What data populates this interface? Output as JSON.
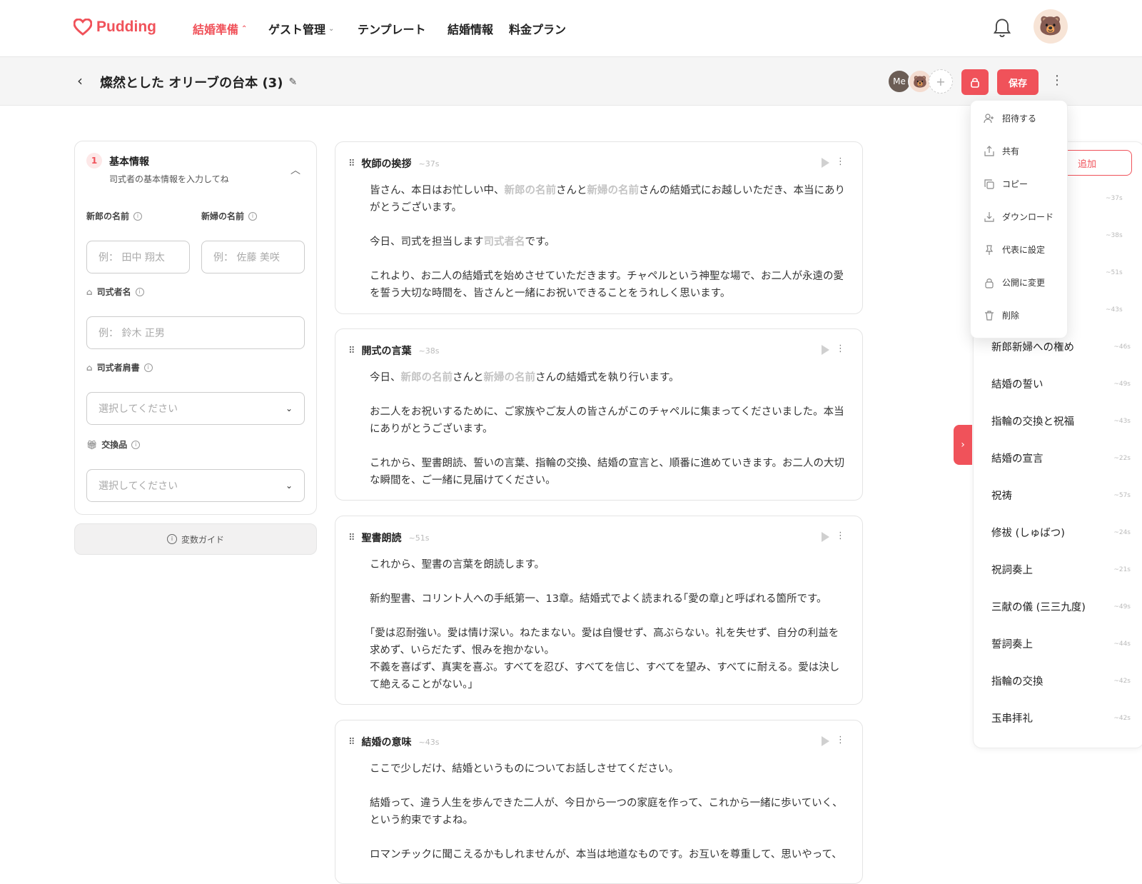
{
  "nav": {
    "logo": "Pudding",
    "items": [
      {
        "label": "結婚準備",
        "active": true,
        "chevron": "⌃"
      },
      {
        "label": "ゲスト管理",
        "active": false,
        "chevron": "⌄"
      },
      {
        "label": "テンプレート",
        "active": false,
        "chevron": ""
      },
      {
        "label": "結婚情報",
        "active": false,
        "chevron": ""
      },
      {
        "label": "料金プラン",
        "active": false,
        "chevron": ""
      }
    ]
  },
  "subbar": {
    "title": "燦然とした オリーブの台本 (3)",
    "me_label": "Me",
    "save_label": "保存"
  },
  "left": {
    "step_number": "1",
    "step_title": "基本情報",
    "step_sub": "司式者の基本情報を入力してね",
    "groom_label": "新郎の名前",
    "bride_label": "新婦の名前",
    "groom_placeholder": "例： 田中 翔太",
    "bride_placeholder": "例： 佐藤 美咲",
    "officiant_label": "司式者名",
    "officiant_placeholder": "例： 鈴木 正男",
    "title_label": "司式者肩書",
    "title_select": "選択してください",
    "gift_label": "交換品",
    "gift_select": "選択してください",
    "guide_label": "変数ガイド"
  },
  "scripts": [
    {
      "title": "牧師の挨拶",
      "time": "~37s"
    },
    {
      "title": "開式の言葉",
      "time": "~38s"
    },
    {
      "title": "聖書朗読",
      "time": "~51s"
    },
    {
      "title": "結婚の意味",
      "time": "~43s"
    }
  ],
  "script_text": {
    "s1p1a": "皆さん、本日はお忙しい中、",
    "v_groom": "新郎の名前",
    "s1p1b": "さんと",
    "v_bride": "新婦の名前",
    "s1p1c": "さんの結婚式にお越しいただき、本当にありがとうございます。",
    "s1p2a": "今日、司式を担当します",
    "v_officiant": "司式者名",
    "s1p2b": "です。",
    "s1p3": "これより、お二人の結婚式を始めさせていただきます。チャペルという神聖な場で、お二人が永遠の愛を誓う大切な時間を、皆さんと一緒にお祝いできることをうれしく思います。",
    "s2p1a": "今日、",
    "s2p1b": "さんと",
    "s2p1c": "さんの結婚式を執り行います。",
    "s2p2": "お二人をお祝いするために、ご家族やご友人の皆さんがこのチャペルに集まってくださいました。本当にありがとうございます。",
    "s2p3": "これから、聖書朗読、誓いの言葉、指輪の交換、結婚の宣言と、順番に進めていきます。お二人の大切な瞬間を、ご一緒に見届けてください。",
    "s3p1": "これから、聖書の言葉を朗読します。",
    "s3p2": "新約聖書、コリント人への手紙第一、13章。結婚式でよく読まれる｢愛の章｣と呼ばれる箇所です。",
    "s3p3": "｢愛は忍耐強い。愛は情け深い。ねたまない。愛は自慢せず、高ぶらない。礼を失せず、自分の利益を求めず、いらだたず、恨みを抱かない。",
    "s3p4": "不義を喜ばず、真実を喜ぶ。すべてを忍び、すべてを信じ、すべてを望み、すべてに耐える。愛は決して絶えることがない。｣",
    "s4p1": "ここで少しだけ、結婚というものについてお話しさせてください。",
    "s4p2": "結婚って、違う人生を歩んできた二人が、今日から一つの家庭を作って、これから一緒に歩いていく、という約束ですよね。",
    "s4p3": "ロマンチックに聞こえるかもしれませんが、本当は地道なものです。お互いを尊重して、思いやって、"
  },
  "menu": {
    "items": [
      {
        "label": "招待する",
        "icon": "user-plus-icon"
      },
      {
        "label": "共有",
        "icon": "share-icon"
      },
      {
        "label": "コピー",
        "icon": "copy-icon"
      },
      {
        "label": "ダウンロード",
        "icon": "download-icon"
      },
      {
        "label": "代表に設定",
        "icon": "pin-icon"
      },
      {
        "label": "公開に変更",
        "icon": "lock-icon"
      },
      {
        "label": "削除",
        "icon": "trash-icon"
      }
    ]
  },
  "right": {
    "add_label": "追加",
    "hidden_times": [
      "~37s",
      "~38s",
      "~51s",
      "~43s"
    ],
    "items": [
      {
        "name": "新郎新婦への権め",
        "time": "~46s"
      },
      {
        "name": "結婚の誓い",
        "time": "~49s"
      },
      {
        "name": "指輪の交換と祝福",
        "time": "~43s"
      },
      {
        "name": "結婚の宣言",
        "time": "~22s"
      },
      {
        "name": "祝祷",
        "time": "~57s"
      },
      {
        "name": "修祓 (しゅばつ)",
        "time": "~24s"
      },
      {
        "name": "祝詞奏上",
        "time": "~21s"
      },
      {
        "name": "三献の儀 (三三九度)",
        "time": "~49s"
      },
      {
        "name": "誓詞奏上",
        "time": "~44s"
      },
      {
        "name": "指輪の交換",
        "time": "~42s"
      },
      {
        "name": "玉串拝礼",
        "time": "~42s"
      }
    ]
  },
  "colors": {
    "accent": "#f0525a"
  }
}
